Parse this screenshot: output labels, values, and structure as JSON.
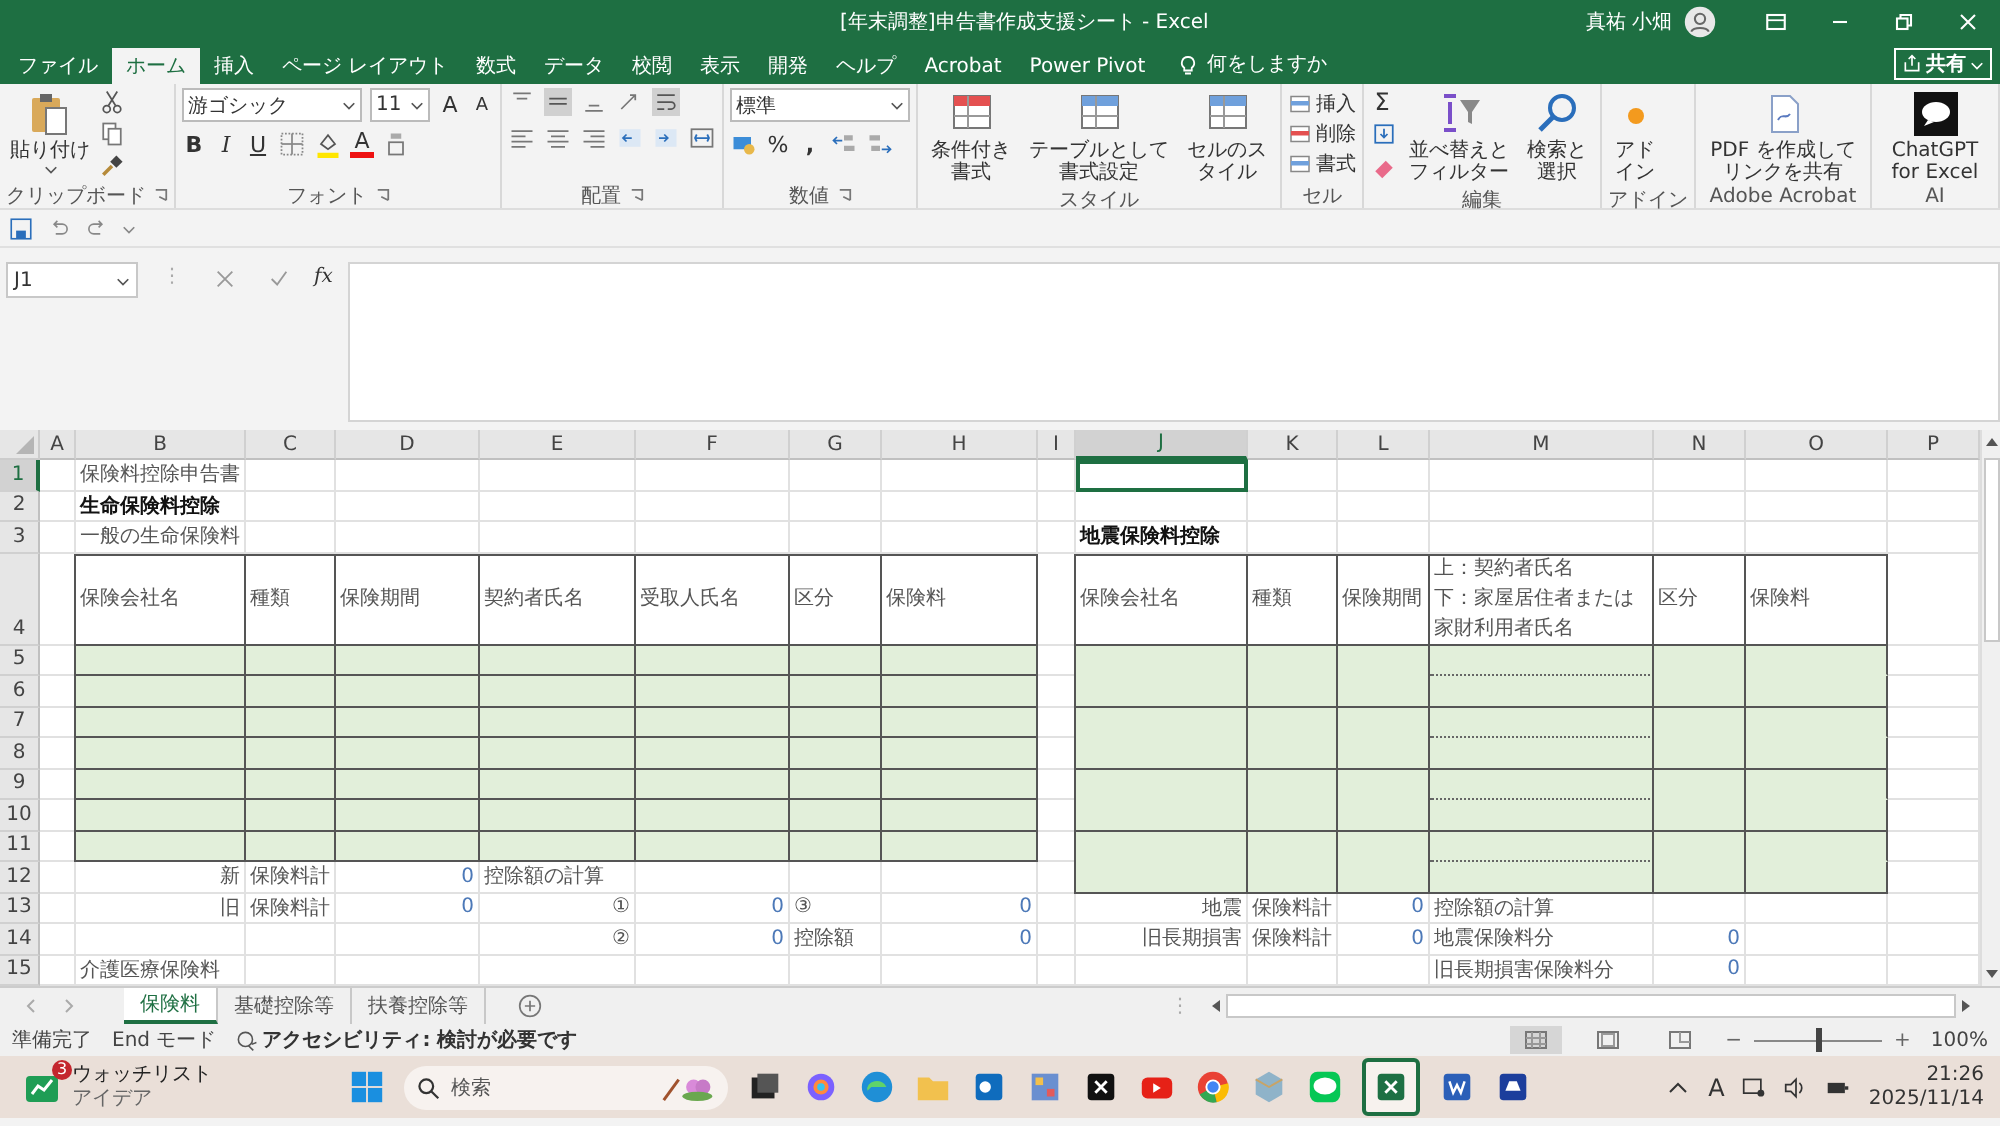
{
  "title_bar": {
    "title": "[年末調整]申告書作成支援シート - Excel",
    "user": "真祐 小畑"
  },
  "tabs": [
    {
      "label": "ファイル",
      "selected": false
    },
    {
      "label": "ホーム",
      "selected": true
    },
    {
      "label": "挿入",
      "selected": false
    },
    {
      "label": "ページ レイアウト",
      "selected": false
    },
    {
      "label": "数式",
      "selected": false
    },
    {
      "label": "データ",
      "selected": false
    },
    {
      "label": "校閲",
      "selected": false
    },
    {
      "label": "表示",
      "selected": false
    },
    {
      "label": "開発",
      "selected": false
    },
    {
      "label": "ヘルプ",
      "selected": false
    },
    {
      "label": "Acrobat",
      "selected": false
    },
    {
      "label": "Power Pivot",
      "selected": false
    }
  ],
  "tell_me": "何をしますか",
  "share": "共有",
  "ribbon": {
    "groups": [
      {
        "label": "クリップボード",
        "paste": "貼り付け"
      },
      {
        "label": "フォント",
        "font_name": "游ゴシック",
        "font_size": "11",
        "grow": "A",
        "shrink": "A",
        "bold": "B",
        "italic": "I",
        "underline": "U",
        "font_color": "A"
      },
      {
        "label": "配置"
      },
      {
        "label": "数値",
        "number_format": "標準",
        "percent": "%",
        "comma": ","
      },
      {
        "label": "スタイル",
        "buttons": [
          "条件付き書式",
          "テーブルとして書式設定",
          "セルのスタイル"
        ]
      },
      {
        "label": "セル",
        "buttons": [
          "挿入",
          "削除",
          "書式"
        ]
      },
      {
        "label": "編集",
        "autosum": "Σ",
        "buttons": [
          "並べ替えとフィルター",
          "検索と選択"
        ]
      },
      {
        "label": "アドイン",
        "buttons": [
          "アドイン"
        ]
      },
      {
        "label": "Adobe Acrobat",
        "buttons": [
          "PDF を作成してリンクを共有"
        ]
      },
      {
        "label": "AI",
        "buttons": [
          "ChatGPT for Excel"
        ]
      }
    ]
  },
  "formula_bar": {
    "name_box": "J1",
    "separator": "⋮",
    "function_label": "fx"
  },
  "sheet": {
    "columns": [
      {
        "label": "A",
        "selected": false
      },
      {
        "label": "B",
        "selected": false
      },
      {
        "label": "C",
        "selected": false
      },
      {
        "label": "D",
        "selected": false
      },
      {
        "label": "E",
        "selected": false
      },
      {
        "label": "F",
        "selected": false
      },
      {
        "label": "G",
        "selected": false
      },
      {
        "label": "H",
        "selected": false
      },
      {
        "label": "I",
        "selected": false
      },
      {
        "label": "J",
        "selected": true
      },
      {
        "label": "K",
        "selected": false
      },
      {
        "label": "L",
        "selected": false
      },
      {
        "label": "M",
        "selected": false
      },
      {
        "label": "N",
        "selected": false
      },
      {
        "label": "O",
        "selected": false
      },
      {
        "label": "P",
        "selected": false
      }
    ],
    "rows": [
      {
        "label": "1",
        "selected": true,
        "cells": [
          {
            "kind": "blank"
          },
          {
            "kind": "text",
            "text": "保険料控除申告書"
          },
          {
            "kind": "blank"
          },
          {
            "kind": "blank"
          },
          {
            "kind": "blank"
          },
          {
            "kind": "blank"
          },
          {
            "kind": "blank"
          },
          {
            "kind": "blank"
          },
          {
            "kind": "blank"
          },
          {
            "kind": "blank"
          },
          {
            "kind": "blank"
          },
          {
            "kind": "blank"
          },
          {
            "kind": "blank"
          },
          {
            "kind": "blank"
          },
          {
            "kind": "blank"
          },
          {
            "kind": "blank"
          }
        ]
      },
      {
        "label": "2",
        "selected": false,
        "cells": [
          {
            "kind": "blank"
          },
          {
            "kind": "bold",
            "text": "生命保険料控除"
          },
          {
            "kind": "blank"
          },
          {
            "kind": "blank"
          },
          {
            "kind": "blank"
          },
          {
            "kind": "blank"
          },
          {
            "kind": "blank"
          },
          {
            "kind": "blank"
          },
          {
            "kind": "blank"
          },
          {
            "kind": "blank"
          },
          {
            "kind": "blank"
          },
          {
            "kind": "blank"
          },
          {
            "kind": "blank"
          },
          {
            "kind": "blank"
          },
          {
            "kind": "blank"
          },
          {
            "kind": "blank"
          }
        ]
      },
      {
        "label": "3",
        "selected": false,
        "cells": [
          {
            "kind": "blank"
          },
          {
            "kind": "text",
            "text": "一般の生命保険料"
          },
          {
            "kind": "blank"
          },
          {
            "kind": "blank"
          },
          {
            "kind": "blank"
          },
          {
            "kind": "blank"
          },
          {
            "kind": "blank"
          },
          {
            "kind": "blank"
          },
          {
            "kind": "blank"
          },
          {
            "kind": "bold",
            "text": "地震保険料控除"
          },
          {
            "kind": "blank"
          },
          {
            "kind": "blank"
          },
          {
            "kind": "blank"
          },
          {
            "kind": "blank"
          },
          {
            "kind": "blank"
          },
          {
            "kind": "blank"
          }
        ]
      },
      {
        "label": "4",
        "selected": false,
        "cells": [
          {
            "kind": "blank"
          },
          {
            "kind": "header",
            "text": "保険会社名"
          },
          {
            "kind": "header",
            "text": "種類"
          },
          {
            "kind": "header",
            "text": "保険期間"
          },
          {
            "kind": "header",
            "text": "契約者氏名"
          },
          {
            "kind": "header",
            "text": "受取人氏名"
          },
          {
            "kind": "header",
            "text": "区分"
          },
          {
            "kind": "header",
            "text": "保険料"
          },
          {
            "kind": "blank"
          },
          {
            "kind": "header",
            "text": "保険会社名"
          },
          {
            "kind": "header",
            "text": "種類"
          },
          {
            "kind": "header",
            "text": "保険期間"
          },
          {
            "kind": "header",
            "lines": [
              "上：契約者氏名",
              "下：家屋居住者または",
              "家財利用者氏名"
            ]
          },
          {
            "kind": "header",
            "text": "区分"
          },
          {
            "kind": "header",
            "text": "保険料"
          },
          {
            "kind": "blank"
          }
        ]
      },
      {
        "label": "5",
        "selected": false,
        "cells": [
          {
            "kind": "blank"
          },
          {
            "kind": "input"
          },
          {
            "kind": "input"
          },
          {
            "kind": "input"
          },
          {
            "kind": "input"
          },
          {
            "kind": "input"
          },
          {
            "kind": "input"
          },
          {
            "kind": "input"
          },
          {
            "kind": "blank"
          },
          {
            "kind": "input_open"
          },
          {
            "kind": "input_open"
          },
          {
            "kind": "input_open"
          },
          {
            "kind": "input_dotted"
          },
          {
            "kind": "input_open"
          },
          {
            "kind": "input_open"
          },
          {
            "kind": "blank"
          }
        ]
      },
      {
        "label": "6",
        "selected": false,
        "cells": [
          {
            "kind": "blank"
          },
          {
            "kind": "input"
          },
          {
            "kind": "input"
          },
          {
            "kind": "input"
          },
          {
            "kind": "input"
          },
          {
            "kind": "input"
          },
          {
            "kind": "input"
          },
          {
            "kind": "input"
          },
          {
            "kind": "blank"
          },
          {
            "kind": "input"
          },
          {
            "kind": "input"
          },
          {
            "kind": "input"
          },
          {
            "kind": "input"
          },
          {
            "kind": "input"
          },
          {
            "kind": "input"
          },
          {
            "kind": "blank"
          }
        ]
      },
      {
        "label": "7",
        "selected": false,
        "cells": [
          {
            "kind": "blank"
          },
          {
            "kind": "input"
          },
          {
            "kind": "input"
          },
          {
            "kind": "input"
          },
          {
            "kind": "input"
          },
          {
            "kind": "input"
          },
          {
            "kind": "input"
          },
          {
            "kind": "input"
          },
          {
            "kind": "blank"
          },
          {
            "kind": "input_open"
          },
          {
            "kind": "input_open"
          },
          {
            "kind": "input_open"
          },
          {
            "kind": "input_dotted"
          },
          {
            "kind": "input_open"
          },
          {
            "kind": "input_open"
          },
          {
            "kind": "blank"
          }
        ]
      },
      {
        "label": "8",
        "selected": false,
        "cells": [
          {
            "kind": "blank"
          },
          {
            "kind": "input"
          },
          {
            "kind": "input"
          },
          {
            "kind": "input"
          },
          {
            "kind": "input"
          },
          {
            "kind": "input"
          },
          {
            "kind": "input"
          },
          {
            "kind": "input"
          },
          {
            "kind": "blank"
          },
          {
            "kind": "input"
          },
          {
            "kind": "input"
          },
          {
            "kind": "input"
          },
          {
            "kind": "input"
          },
          {
            "kind": "input"
          },
          {
            "kind": "input"
          },
          {
            "kind": "blank"
          }
        ]
      },
      {
        "label": "9",
        "selected": false,
        "cells": [
          {
            "kind": "blank"
          },
          {
            "kind": "input"
          },
          {
            "kind": "input"
          },
          {
            "kind": "input"
          },
          {
            "kind": "input"
          },
          {
            "kind": "input"
          },
          {
            "kind": "input"
          },
          {
            "kind": "input"
          },
          {
            "kind": "blank"
          },
          {
            "kind": "input_open"
          },
          {
            "kind": "input_open"
          },
          {
            "kind": "input_open"
          },
          {
            "kind": "input_dotted"
          },
          {
            "kind": "input_open"
          },
          {
            "kind": "input_open"
          },
          {
            "kind": "blank"
          }
        ]
      },
      {
        "label": "10",
        "selected": false,
        "cells": [
          {
            "kind": "blank"
          },
          {
            "kind": "input"
          },
          {
            "kind": "input"
          },
          {
            "kind": "input"
          },
          {
            "kind": "input"
          },
          {
            "kind": "input"
          },
          {
            "kind": "input"
          },
          {
            "kind": "input"
          },
          {
            "kind": "blank"
          },
          {
            "kind": "input"
          },
          {
            "kind": "input"
          },
          {
            "kind": "input"
          },
          {
            "kind": "input"
          },
          {
            "kind": "input"
          },
          {
            "kind": "input"
          },
          {
            "kind": "blank"
          }
        ]
      },
      {
        "label": "11",
        "selected": false,
        "cells": [
          {
            "kind": "blank"
          },
          {
            "kind": "input"
          },
          {
            "kind": "input"
          },
          {
            "kind": "input"
          },
          {
            "kind": "input"
          },
          {
            "kind": "input"
          },
          {
            "kind": "input"
          },
          {
            "kind": "input"
          },
          {
            "kind": "blank"
          },
          {
            "kind": "input_open"
          },
          {
            "kind": "input_open"
          },
          {
            "kind": "input_open"
          },
          {
            "kind": "input_dotted"
          },
          {
            "kind": "input_open"
          },
          {
            "kind": "input_open"
          },
          {
            "kind": "blank"
          }
        ]
      },
      {
        "label": "12",
        "selected": false,
        "cells": [
          {
            "kind": "blank"
          },
          {
            "kind": "right",
            "text": "新"
          },
          {
            "kind": "text",
            "text": "保険料計"
          },
          {
            "kind": "number",
            "text": "0"
          },
          {
            "kind": "text",
            "text": "控除額の計算"
          },
          {
            "kind": "blank"
          },
          {
            "kind": "blank"
          },
          {
            "kind": "blank"
          },
          {
            "kind": "blank"
          },
          {
            "kind": "input"
          },
          {
            "kind": "input"
          },
          {
            "kind": "input"
          },
          {
            "kind": "input"
          },
          {
            "kind": "input"
          },
          {
            "kind": "input"
          },
          {
            "kind": "blank"
          }
        ]
      },
      {
        "label": "13",
        "selected": false,
        "cells": [
          {
            "kind": "blank"
          },
          {
            "kind": "right",
            "text": "旧"
          },
          {
            "kind": "text",
            "text": "保険料計"
          },
          {
            "kind": "number",
            "text": "0"
          },
          {
            "kind": "right",
            "text": "①"
          },
          {
            "kind": "number",
            "text": "0"
          },
          {
            "kind": "text",
            "text": "③"
          },
          {
            "kind": "number",
            "text": "0"
          },
          {
            "kind": "blank"
          },
          {
            "kind": "right",
            "text": "地震"
          },
          {
            "kind": "text",
            "text": "保険料計"
          },
          {
            "kind": "number",
            "text": "0"
          },
          {
            "kind": "text",
            "text": "控除額の計算"
          },
          {
            "kind": "blank"
          },
          {
            "kind": "blank"
          },
          {
            "kind": "blank"
          }
        ]
      },
      {
        "label": "14",
        "selected": false,
        "cells": [
          {
            "kind": "blank"
          },
          {
            "kind": "blank"
          },
          {
            "kind": "blank"
          },
          {
            "kind": "blank"
          },
          {
            "kind": "right",
            "text": "②"
          },
          {
            "kind": "number",
            "text": "0"
          },
          {
            "kind": "text",
            "text": "控除額"
          },
          {
            "kind": "number",
            "text": "0"
          },
          {
            "kind": "blank"
          },
          {
            "kind": "right",
            "text": "旧長期損害"
          },
          {
            "kind": "text",
            "text": "保険料計"
          },
          {
            "kind": "number",
            "text": "0"
          },
          {
            "kind": "text",
            "text": "地震保険料分"
          },
          {
            "kind": "number",
            "text": "0"
          },
          {
            "kind": "blank"
          },
          {
            "kind": "blank"
          }
        ]
      },
      {
        "label": "15",
        "selected": false,
        "cells": [
          {
            "kind": "blank"
          },
          {
            "kind": "text",
            "text": "介護医療保険料"
          },
          {
            "kind": "blank"
          },
          {
            "kind": "blank"
          },
          {
            "kind": "blank"
          },
          {
            "kind": "blank"
          },
          {
            "kind": "blank"
          },
          {
            "kind": "blank"
          },
          {
            "kind": "blank"
          },
          {
            "kind": "blank"
          },
          {
            "kind": "blank"
          },
          {
            "kind": "blank"
          },
          {
            "kind": "text",
            "text": "旧長期損害保険料分"
          },
          {
            "kind": "number",
            "text": "0"
          },
          {
            "kind": "blank"
          },
          {
            "kind": "blank"
          }
        ]
      }
    ]
  },
  "sheet_tab_bar": {
    "tabs": [
      {
        "label": "保険料",
        "selected": true
      },
      {
        "label": "基礎控除等",
        "selected": false
      },
      {
        "label": "扶養控除等",
        "selected": false
      }
    ],
    "split_handle": "⋮"
  },
  "status_bar": {
    "mode": "準備完了",
    "end_mode": "End モード",
    "accessibility": "アクセシビリティ: 検討が必要です",
    "views": [
      {
        "selected": true
      },
      {
        "selected": false
      },
      {
        "selected": false
      }
    ],
    "zoom_out": "−",
    "zoom_in": "+",
    "zoom_slider": {
      "level": 0.5
    },
    "zoom": "100%"
  },
  "taskbar": {
    "widget": {
      "badge": "3",
      "title": "ウォッチリスト",
      "subtitle": "アイデア"
    },
    "search_placeholder": "検索",
    "ime": "A",
    "time": "21:26",
    "date": "2025/11/14"
  }
}
